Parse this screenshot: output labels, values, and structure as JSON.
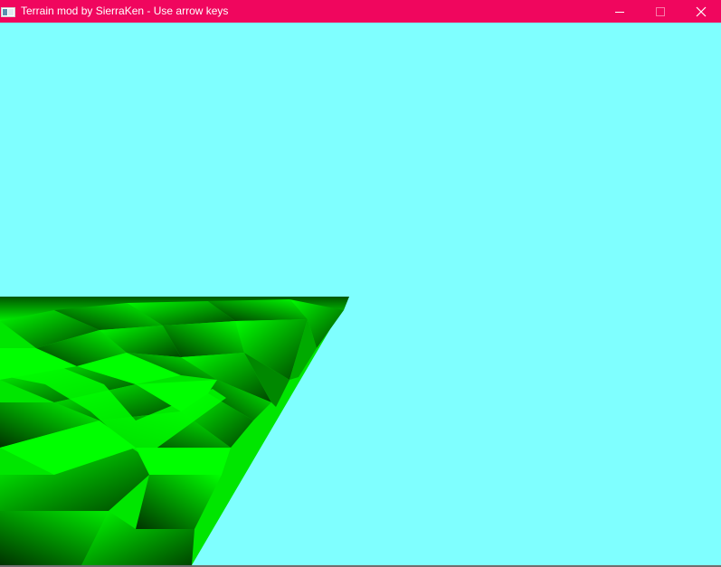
{
  "window": {
    "title": "Terrain mod by SierraKen - Use arrow keys",
    "titlebar_color": "#f0065e",
    "controls": [
      "minimize-icon",
      "maximize-icon",
      "close-icon"
    ]
  },
  "scene": {
    "sky_color": "#7fffff",
    "terrain_color": "#00ff00",
    "terrain_shadow_color": "#003300"
  }
}
